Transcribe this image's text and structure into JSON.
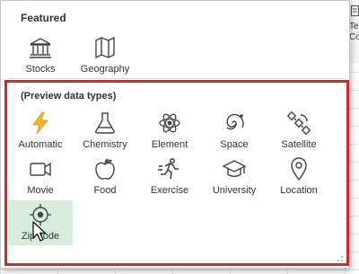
{
  "ribbon": {
    "partial_text_1": "Te",
    "partial_text_2": "Col"
  },
  "featured": {
    "title": "Featured",
    "items": [
      {
        "label": "Stocks",
        "icon": "bank-icon"
      },
      {
        "label": "Geography",
        "icon": "map-icon"
      }
    ]
  },
  "preview": {
    "title": "(Preview data types)",
    "items": [
      {
        "label": "Automatic",
        "icon": "lightning-icon"
      },
      {
        "label": "Chemistry",
        "icon": "flask-icon"
      },
      {
        "label": "Element",
        "icon": "atom-icon"
      },
      {
        "label": "Space",
        "icon": "galaxy-icon"
      },
      {
        "label": "Satellite",
        "icon": "satellite-icon"
      },
      {
        "label": "Movie",
        "icon": "video-camera-icon"
      },
      {
        "label": "Food",
        "icon": "apple-icon"
      },
      {
        "label": "Exercise",
        "icon": "running-person-icon"
      },
      {
        "label": "University",
        "icon": "graduation-cap-icon"
      },
      {
        "label": "Location",
        "icon": "map-pin-icon"
      },
      {
        "label": "Zip code",
        "icon": "crosshair-icon"
      }
    ]
  },
  "colors": {
    "highlight_border": "#e0232b",
    "selected_bg": "#d8ecdd",
    "automatic_icon": "#f5b32b"
  }
}
